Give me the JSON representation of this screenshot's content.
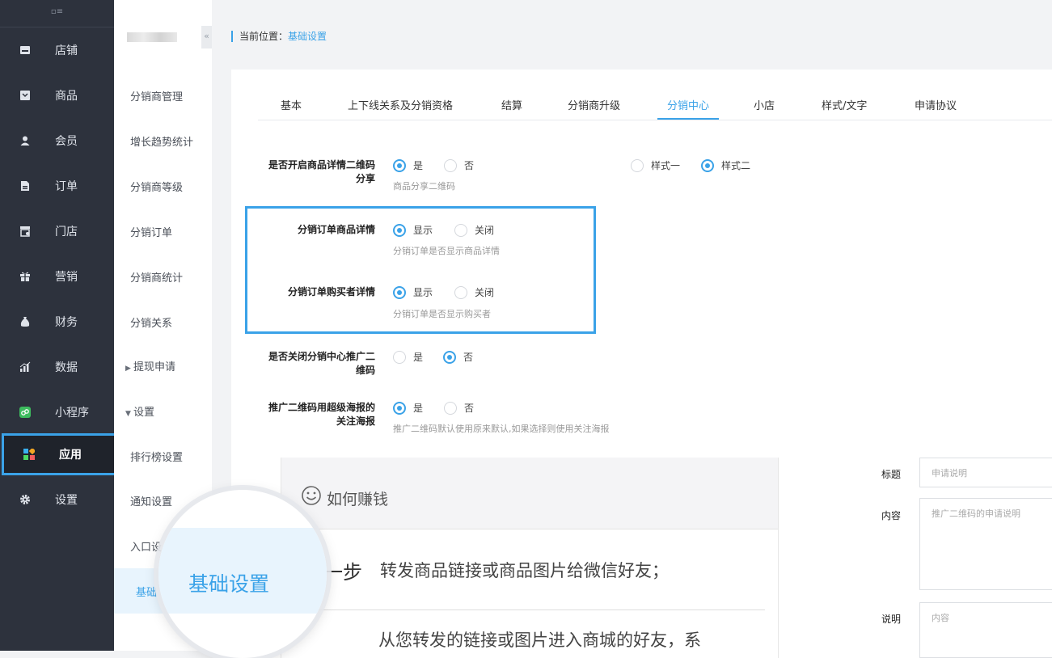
{
  "nav": {
    "items": [
      {
        "label": "店铺",
        "icon": "store-icon"
      },
      {
        "label": "商品",
        "icon": "goods-icon"
      },
      {
        "label": "会员",
        "icon": "member-icon"
      },
      {
        "label": "订单",
        "icon": "order-icon"
      },
      {
        "label": "门店",
        "icon": "shop-icon"
      },
      {
        "label": "营销",
        "icon": "gift-icon"
      },
      {
        "label": "财务",
        "icon": "money-bag-icon"
      },
      {
        "label": "数据",
        "icon": "chart-icon"
      },
      {
        "label": "小程序",
        "icon": "mini-program-icon"
      },
      {
        "label": "应用",
        "icon": "apps-icon"
      },
      {
        "label": "设置",
        "icon": "gear-icon"
      }
    ],
    "active": "应用"
  },
  "subnav": {
    "items": [
      "分销商管理",
      "增长趋势统计",
      "分销商等级",
      "分销订单",
      "分销商统计",
      "分销关系",
      "提现申请",
      "设置",
      "排行榜设置",
      "通知设置",
      "入口设",
      "基础"
    ]
  },
  "breadcrumb": {
    "prefix": "当前位置：",
    "current": "基础设置"
  },
  "tabs": [
    "基本",
    "上下线关系及分销资格",
    "结算",
    "分销商升级",
    "分销中心",
    "小店",
    "样式/文字",
    "申请协议"
  ],
  "active_tab": "分销中心",
  "form": {
    "qr_share": {
      "label": "是否开启商品详情二维码分享",
      "yes": "是",
      "no": "否",
      "hint": "商品分享二维码",
      "style1": "样式一",
      "style2": "样式二"
    },
    "order_goods": {
      "label": "分销订单商品详情",
      "show": "显示",
      "close": "关闭",
      "hint": "分销订单是否显示商品详情"
    },
    "order_buyer": {
      "label": "分销订单购买者详情",
      "show": "显示",
      "close": "关闭",
      "hint": "分销订单是否显示购买者"
    },
    "close_qr": {
      "label": "是否关闭分销中心推广二维码",
      "yes": "是",
      "no": "否"
    },
    "super_poster": {
      "label": "推广二维码用超级海报的关注海报",
      "yes": "是",
      "no": "否",
      "hint": "推广二维码默认使用原来默认,如果选择则使用关注海报"
    }
  },
  "preview": {
    "title": "如何赚钱",
    "step1_label": "一步",
    "step1_text": "转发商品链接或商品图片给微信好友；",
    "step2_text": "从您转发的链接或图片进入商城的好友，系"
  },
  "right_form": {
    "title_label": "标题",
    "title_placeholder": "申请说明",
    "content_label": "内容",
    "content_placeholder": "推广二维码的申请说明",
    "desc_label": "说明",
    "desc_placeholder": "内容"
  },
  "magnifier": {
    "text": "基础设置"
  },
  "colors": {
    "accent": "#3aa2e8",
    "nav_bg": "#2d323d"
  }
}
